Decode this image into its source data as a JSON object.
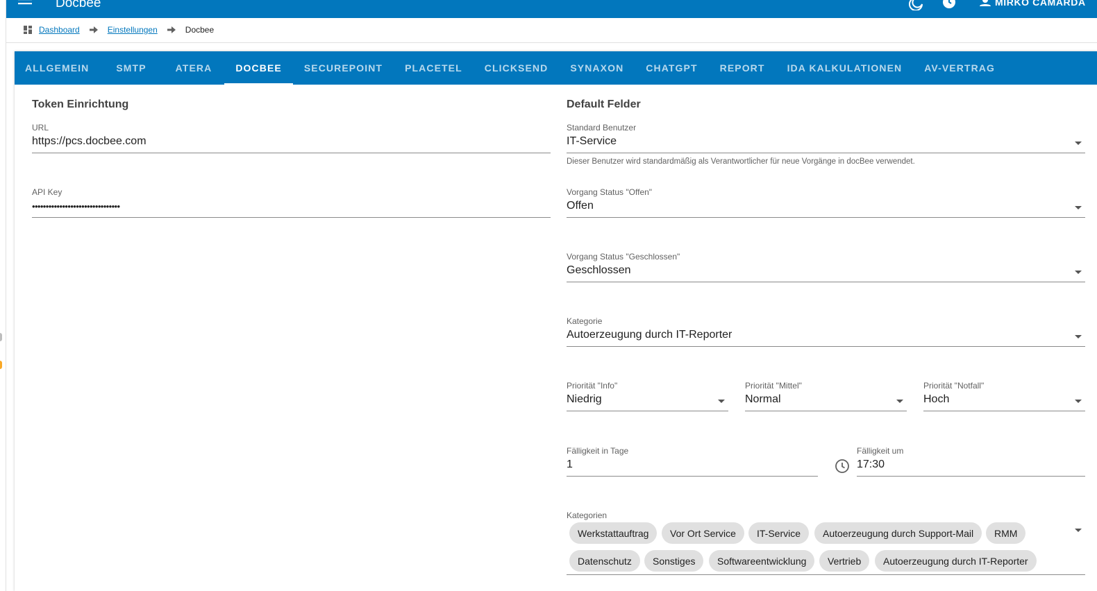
{
  "app": {
    "title": "Docbee",
    "user": "MIRKO CAMARDA"
  },
  "breadcrumb": {
    "items": [
      "Dashboard",
      "Einstellungen"
    ],
    "current": "Docbee"
  },
  "tabs": [
    "ALLGEMEIN",
    "SMTP",
    "ATERA",
    "DOCBEE",
    "SECUREPOINT",
    "PLACETEL",
    "CLICKSEND",
    "SYNAXON",
    "CHATGPT",
    "REPORT",
    "IDA KALKULATIONEN",
    "AV-VERTRAG"
  ],
  "active_tab": "DOCBEE",
  "token": {
    "title": "Token Einrichtung",
    "url_label": "URL",
    "url_value": "https://pcs.docbee.com",
    "apikey_label": "API Key",
    "apikey_value": "••••••••••••••••••••••••••••••••"
  },
  "defaults": {
    "title": "Default Felder",
    "standard_user_label": "Standard Benutzer",
    "standard_user_value": "IT-Service",
    "standard_user_hint": "Dieser Benutzer wird standardmäßig als Verantwortlicher für neue Vorgänge in docBee verwendet.",
    "status_open_label": "Vorgang Status \"Offen\"",
    "status_open_value": "Offen",
    "status_closed_label": "Vorgang Status \"Geschlossen\"",
    "status_closed_value": "Geschlossen",
    "category_label": "Kategorie",
    "category_value": "Autoerzeugung durch IT-Reporter",
    "prio_info_label": "Priorität \"Info\"",
    "prio_info_value": "Niedrig",
    "prio_mittel_label": "Priorität \"Mittel\"",
    "prio_mittel_value": "Normal",
    "prio_notfall_label": "Priorität \"Notfall\"",
    "prio_notfall_value": "Hoch",
    "due_days_label": "Fälligkeit in Tage",
    "due_days_value": "1",
    "due_time_label": "Fälligkeit um",
    "due_time_value": "17:30",
    "categories_label": "Kategorien",
    "categories": [
      "Werkstattauftrag",
      "Vor Ort Service",
      "IT-Service",
      "Autoerzeugung durch Support-Mail",
      "RMM",
      "Datenschutz",
      "Sonstiges",
      "Softwareentwicklung",
      "Vertrieb",
      "Autoerzeugung durch IT-Reporter"
    ]
  },
  "colors": {
    "primary": "#0277bd",
    "chip": "#e0e0e0",
    "accent": "#f9a825"
  }
}
